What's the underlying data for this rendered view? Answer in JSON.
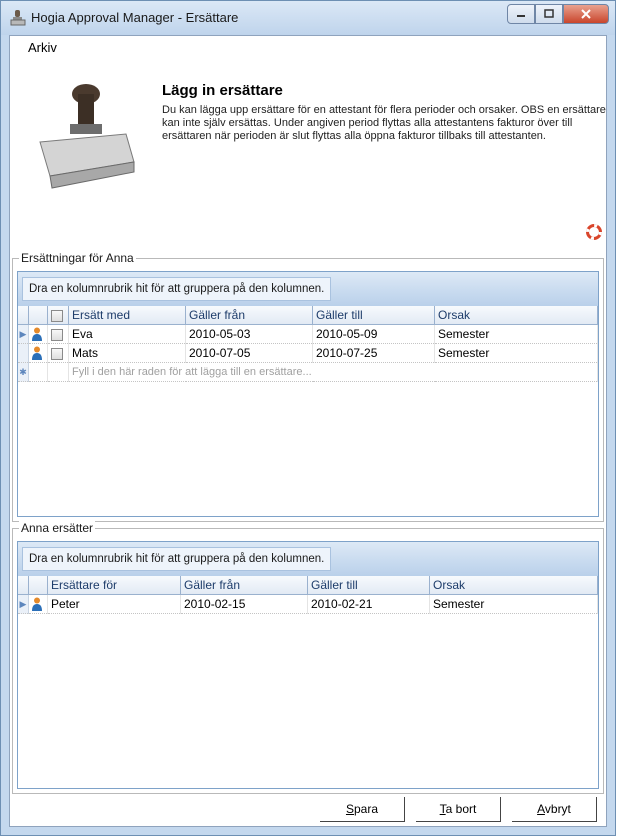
{
  "window": {
    "title": "Hogia Approval Manager - Ersättare"
  },
  "menu": {
    "arkiv": "Arkiv"
  },
  "header": {
    "title": "Lägg in ersättare",
    "description": "Du kan lägga upp ersättare för en attestant för flera perioder och orsaker. OBS en ersättare kan inte själv ersättas. Under angiven period flyttas alla attestantens fakturor över till ersättaren när perioden är slut flyttas alla öppna fakturor tillbaks till attestanten."
  },
  "group_hint": "Dra en kolumnrubrik hit för att gruppera på den kolumnen.",
  "substitutes": {
    "legend": "Ersättningar för Anna",
    "columns": [
      "Ersätt med",
      "Gäller från",
      "Gäller till",
      "Orsak"
    ],
    "rows": [
      {
        "name": "Eva",
        "from": "2010-05-03",
        "to": "2010-05-09",
        "reason": "Semester"
      },
      {
        "name": "Mats",
        "from": "2010-07-05",
        "to": "2010-07-25",
        "reason": "Semester"
      }
    ],
    "new_row_hint": "Fyll i den här raden för att lägga till en ersättare..."
  },
  "replaces": {
    "legend": "Anna ersätter",
    "columns": [
      "Ersättare för",
      "Gäller från",
      "Gäller till",
      "Orsak"
    ],
    "rows": [
      {
        "name": "Peter",
        "from": "2010-02-15",
        "to": "2010-02-21",
        "reason": "Semester"
      }
    ]
  },
  "buttons": {
    "save_mn": "S",
    "save_rest": "para",
    "delete_mn": "T",
    "delete_rest": "a bort",
    "cancel_mn": "A",
    "cancel_rest": "vbryt"
  }
}
